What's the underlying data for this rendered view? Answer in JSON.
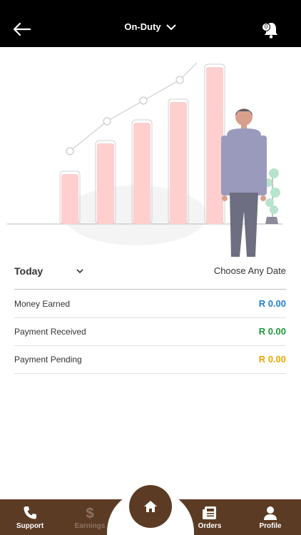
{
  "header": {
    "title": "On-Duty",
    "notification_count": "0"
  },
  "filter": {
    "period": "Today",
    "choose_date": "Choose Any Date"
  },
  "summary": [
    {
      "label": "Money Earned",
      "value": "R 0.00",
      "color": "#1e7fd6"
    },
    {
      "label": "Payment Received",
      "value": "R 0.00",
      "color": "#1a9b3a"
    },
    {
      "label": "Payment Pending",
      "value": "R 0.00",
      "color": "#f0a500"
    }
  ],
  "bottom_nav": {
    "support": "Support",
    "earnings": "Earnings",
    "orders": "Orders",
    "profile": "Profile"
  },
  "colors": {
    "topbar": "#000000",
    "nav": "#5c3b24"
  }
}
